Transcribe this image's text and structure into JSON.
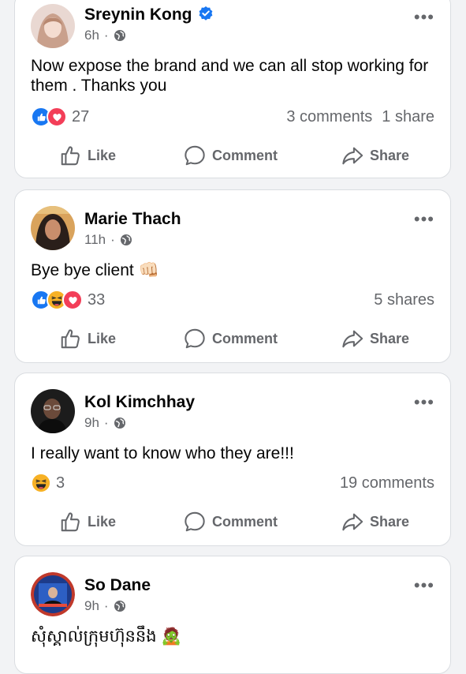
{
  "colors": {
    "background": "#f2f3f5",
    "card": "#ffffff",
    "secondary_text": "#65676b",
    "verified_blue": "#1877f2",
    "like_blue": "#1877f2",
    "love_red": "#f33e58",
    "haha_yellow": "#f7b125"
  },
  "actions": {
    "like": "Like",
    "comment": "Comment",
    "share": "Share"
  },
  "icons": {
    "more": "more-options-icon",
    "privacy": "globe-icon",
    "verified": "verified-badge-icon",
    "like": "thumbs-up-icon",
    "comment": "comment-bubble-icon",
    "share": "share-arrow-icon"
  },
  "posts": [
    {
      "author": "Sreynin Kong",
      "verified": true,
      "time": "6h",
      "separator": "·",
      "more": "•••",
      "text": "Now expose the brand and we can all stop working for them . Thanks you",
      "reactions": [
        "like",
        "love"
      ],
      "reaction_count": "27",
      "comments": "3 comments",
      "shares": "1 share"
    },
    {
      "author": "Marie Thach",
      "verified": false,
      "time": "11h",
      "separator": "·",
      "more": "•••",
      "text": "Bye bye client 👊🏻",
      "reactions": [
        "like",
        "haha",
        "love"
      ],
      "reaction_count": "33",
      "comments": "",
      "shares": "5 shares"
    },
    {
      "author": "Kol Kimchhay",
      "verified": false,
      "time": "9h",
      "separator": "·",
      "more": "•••",
      "text": "I really want to know who they are!!!",
      "reactions": [
        "haha"
      ],
      "reaction_count": "3",
      "comments": "19 comments",
      "shares": ""
    },
    {
      "author": "So Dane",
      "verified": false,
      "time": "9h",
      "separator": "·",
      "more": "•••",
      "text": "សុំស្គាល់ក្រុមហ៊ុននឹង 🧟",
      "reactions": [],
      "reaction_count": "",
      "comments": "",
      "shares": ""
    }
  ]
}
